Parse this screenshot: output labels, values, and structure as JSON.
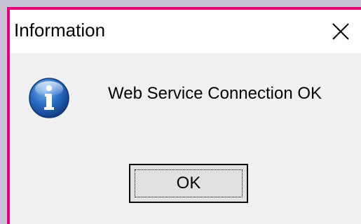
{
  "dialog": {
    "title": "Information",
    "message": "Web Service Connection OK",
    "icon": "info-icon",
    "close_icon": "close-icon",
    "ok_label": "OK"
  },
  "colors": {
    "window_border": "#e6007e",
    "titlebar_bg": "#ffffff",
    "dialog_bg": "#f0f0f0",
    "button_bg": "#e1e1e1",
    "icon_blue": "#1e5fb4"
  }
}
